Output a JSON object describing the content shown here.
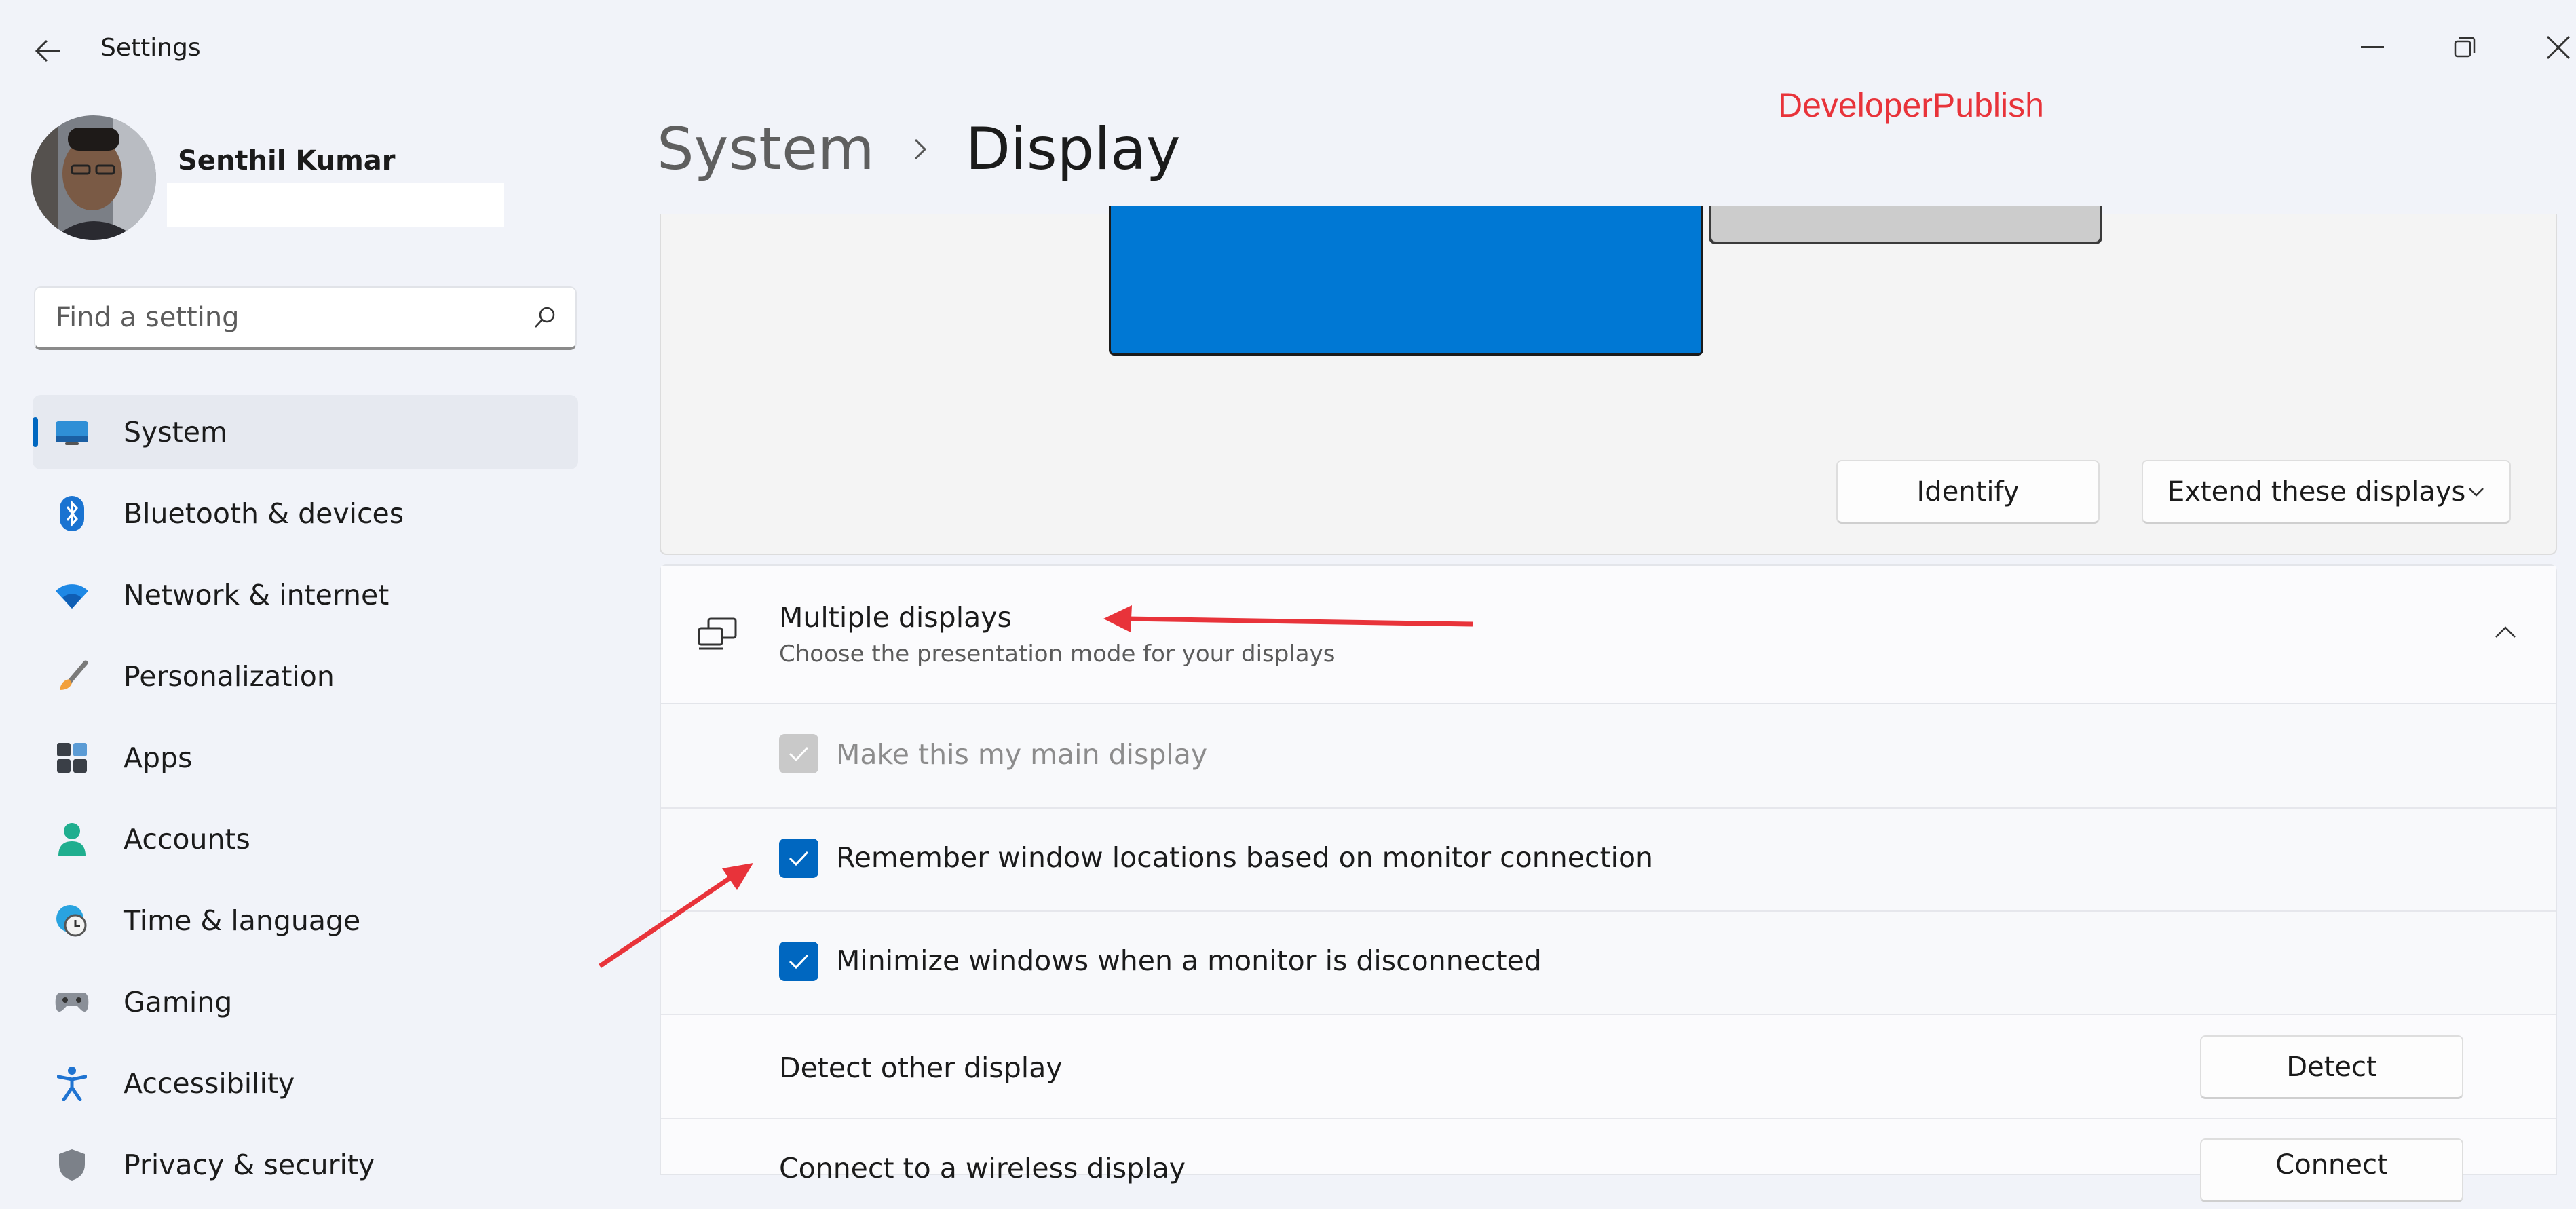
{
  "window": {
    "title": "Settings",
    "controls": {
      "minimize": "minimize-icon",
      "maximize": "restore-icon",
      "close": "close-icon"
    }
  },
  "profile": {
    "name": "Senthil Kumar"
  },
  "search": {
    "placeholder": "Find a setting"
  },
  "sidebar": {
    "items": [
      {
        "label": "System",
        "icon": "monitor-icon",
        "selected": true
      },
      {
        "label": "Bluetooth & devices",
        "icon": "bluetooth-icon"
      },
      {
        "label": "Network & internet",
        "icon": "wifi-icon"
      },
      {
        "label": "Personalization",
        "icon": "brush-icon"
      },
      {
        "label": "Apps",
        "icon": "apps-icon"
      },
      {
        "label": "Accounts",
        "icon": "person-icon"
      },
      {
        "label": "Time & language",
        "icon": "clock-globe-icon"
      },
      {
        "label": "Gaming",
        "icon": "gamepad-icon"
      },
      {
        "label": "Accessibility",
        "icon": "accessibility-icon"
      },
      {
        "label": "Privacy & security",
        "icon": "shield-icon"
      }
    ]
  },
  "header": {
    "breadcrumb_parent": "System",
    "breadcrumb_current": "Display",
    "watermark": "DeveloperPublish"
  },
  "arrangement": {
    "identify_label": "Identify",
    "mode_selected": "Extend these displays"
  },
  "multiple_displays": {
    "title": "Multiple displays",
    "subtitle": "Choose the presentation mode for your displays",
    "options": [
      {
        "label": "Make this my main display",
        "checked": true,
        "disabled": true
      },
      {
        "label": "Remember window locations based on monitor connection",
        "checked": true,
        "disabled": false
      },
      {
        "label": "Minimize windows when a monitor is disconnected",
        "checked": true,
        "disabled": false
      }
    ],
    "detect_label": "Detect other display",
    "detect_button": "Detect",
    "connect_label": "Connect to a wireless display",
    "connect_button": "Connect"
  },
  "colors": {
    "accent": "#0067c0",
    "monitor_primary": "#0078d4",
    "annotation": "#e8333a"
  }
}
